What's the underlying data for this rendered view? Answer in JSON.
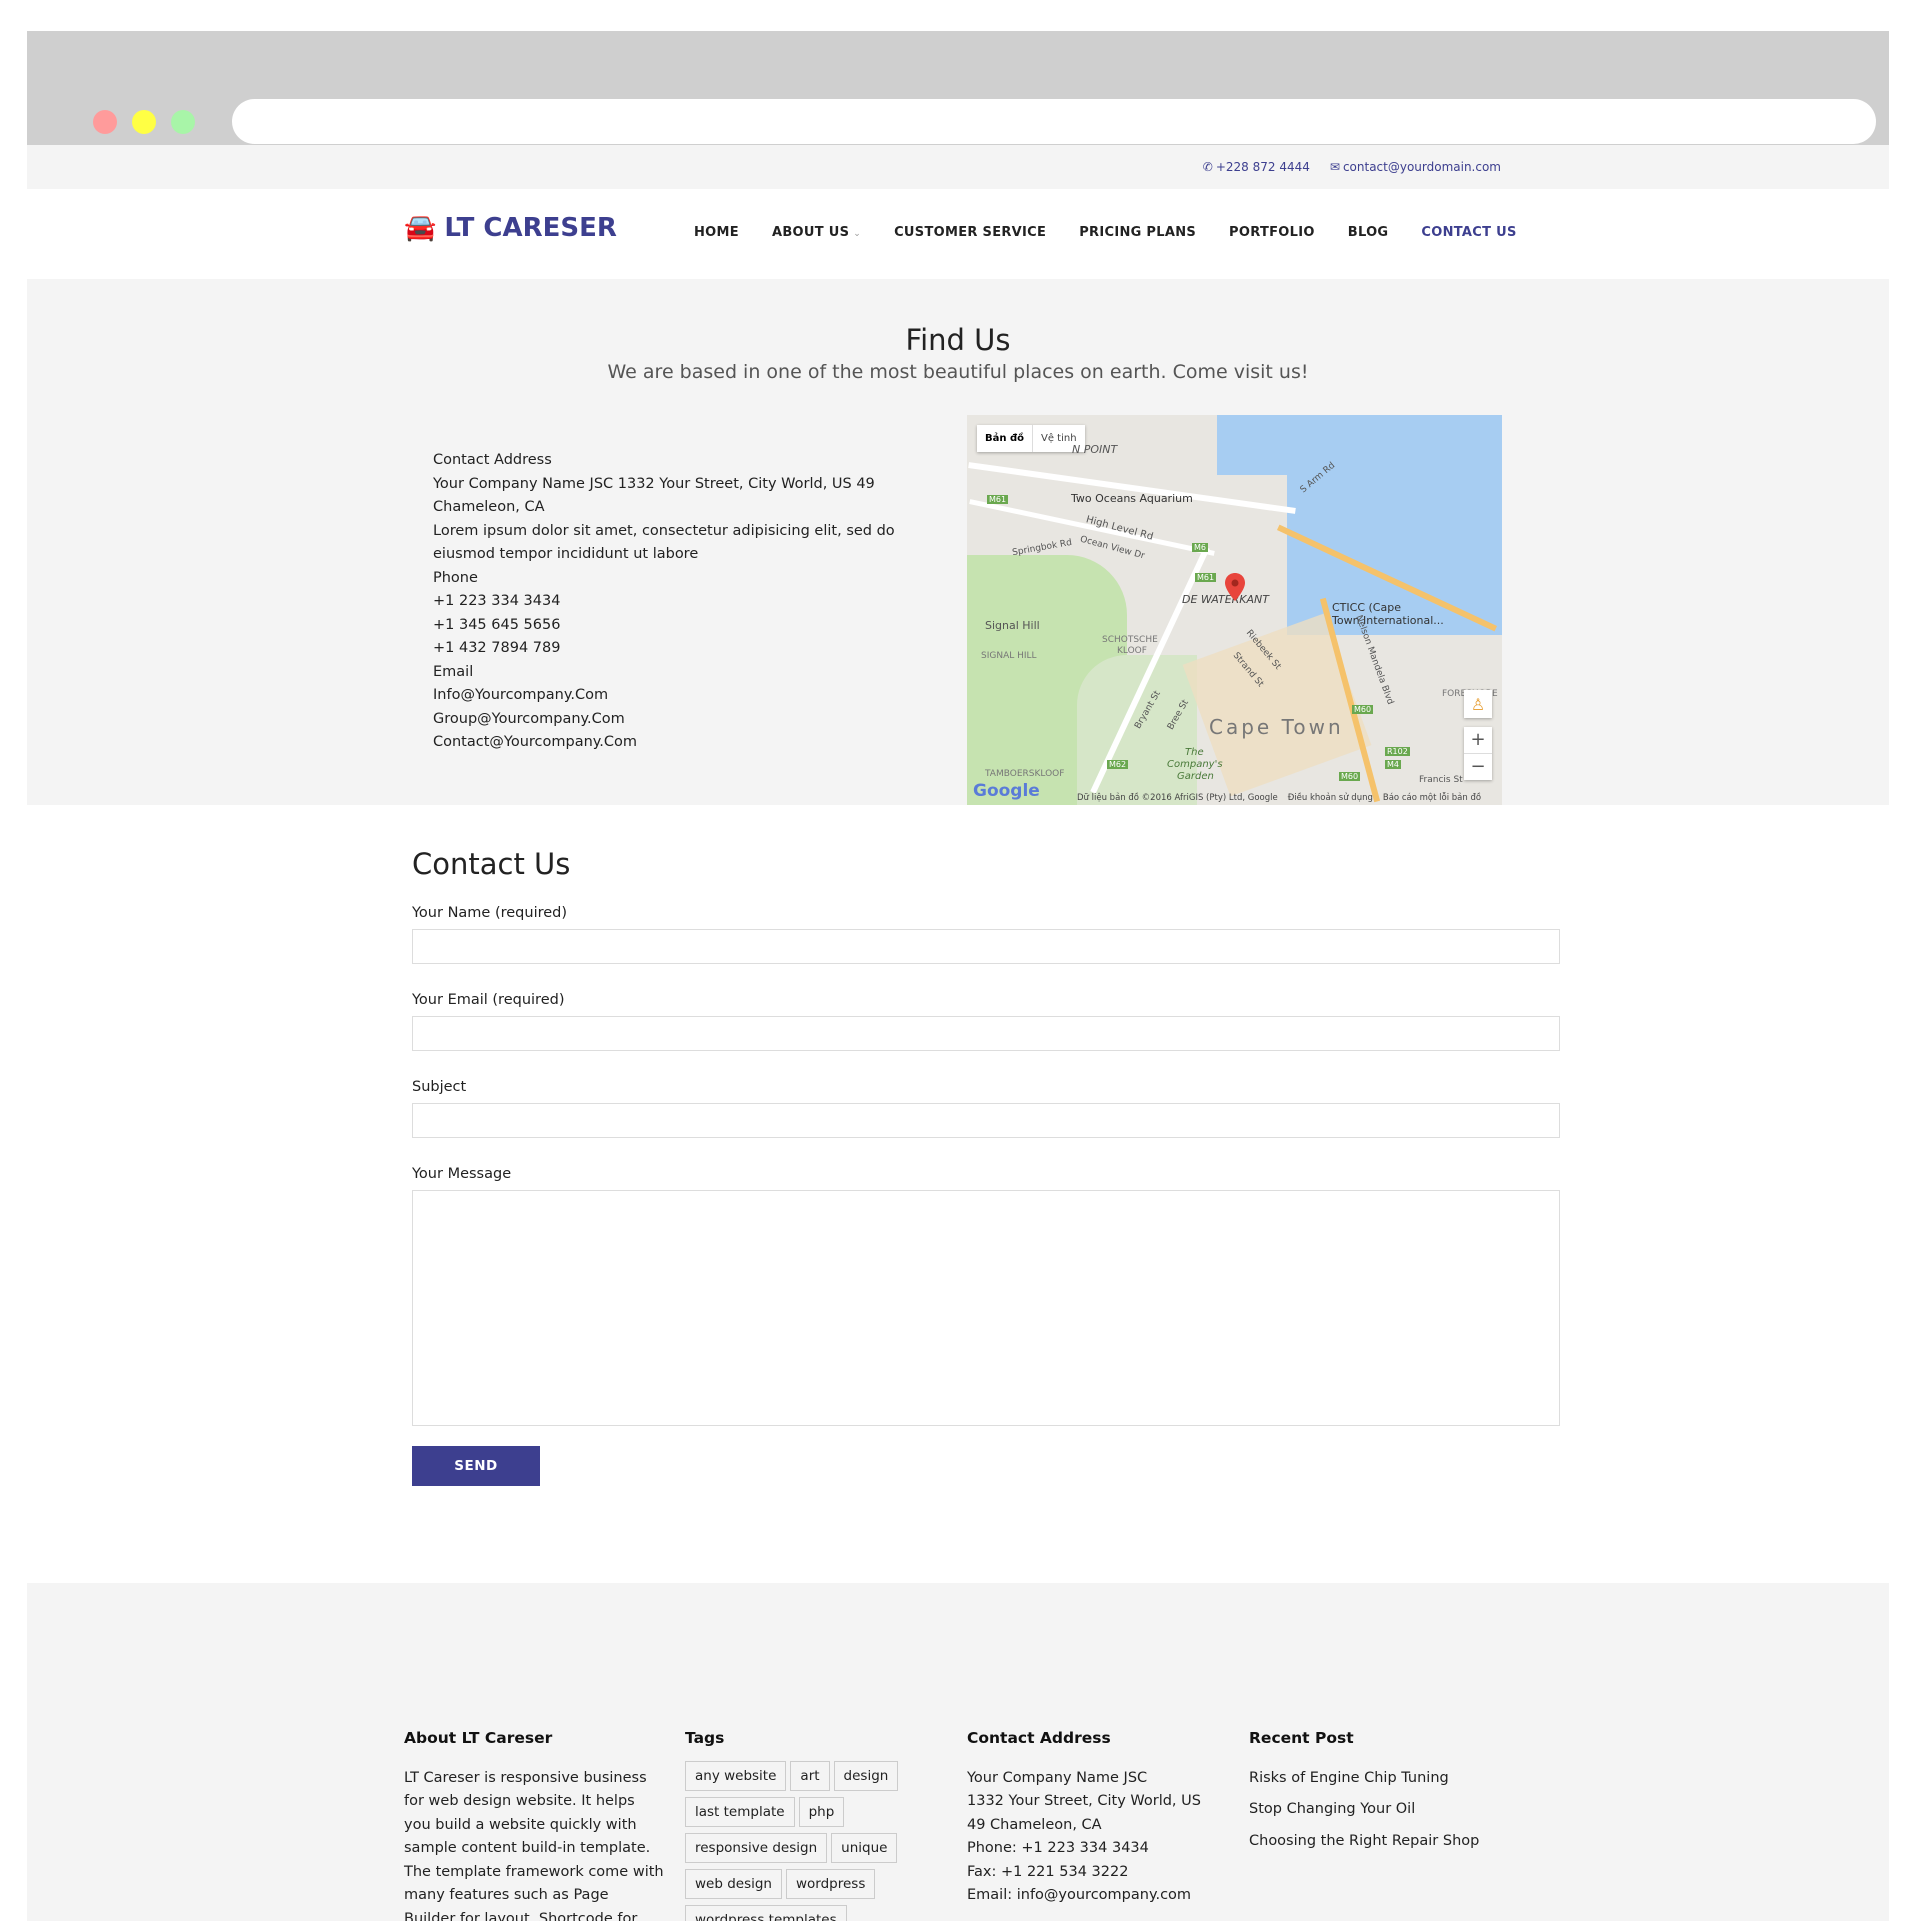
{
  "topbar": {
    "phone": "+228 872 4444",
    "email": "contact@yourdomain.com"
  },
  "logo": {
    "text": "LT CARESER"
  },
  "nav": {
    "home": "HOME",
    "about": "ABOUT US",
    "customer_service": "CUSTOMER SERVICE",
    "pricing": "PRICING PLANS",
    "portfolio": "PORTFOLIO",
    "blog": "BLOG",
    "contact": "CONTACT US"
  },
  "findus": {
    "title": "Find Us",
    "subtitle": "We are based in one of the most beautiful places on earth. Come visit us!",
    "address_lines": [
      "Contact Address",
      "Your Company Name JSC 1332 Your Street, City World, US 49",
      "Chameleon, CA",
      "Lorem ipsum dolor sit amet, consectetur adipisicing elit, sed do",
      "eiusmod tempor incididunt ut labore",
      "Phone",
      "+1 223 334 3434",
      "+1 345 645 5656",
      "+1 432 7894 789",
      "Email",
      "Info@Yourcompany.Com",
      "Group@Yourcompany.Com",
      "Contact@Yourcompany.Com"
    ]
  },
  "map": {
    "tab_map": "Bản đồ",
    "tab_satellite": "Vệ tinh",
    "labels": {
      "point": "N POINT",
      "aquarium": "Two Oceans Aquarium",
      "high_level": "High Level Rd",
      "springbok": "Springbok Rd",
      "ocean_view": "Ocean View Dr",
      "waterkant": "DE WATERKANT",
      "ctcc": "CTICC (Cape",
      "ctcc2": "Town International...",
      "signal_hill": "Signal Hill",
      "signal_hill2": "SIGNAL HILL",
      "schotsche": "SCHOTSCHE",
      "kloof": "KLOOF",
      "cape_town": "Cape Town",
      "tamboers": "TAMBOERSKLOOF",
      "company": "The",
      "company2": "Company's",
      "company3": "Garden",
      "nelson": "Nelson Mandela Blvd",
      "francis": "Francis St",
      "riebeek": "Riebeek St",
      "strand": "Strand St",
      "bree": "Bree St",
      "bryant": "Bryant St",
      "m6": "M6",
      "m61": "M61",
      "m60": "M60",
      "m62": "M62",
      "m4": "M4",
      "r102": "R102",
      "s_arm": "S Arm Rd",
      "fore": "FORESHORE"
    },
    "google": "Google",
    "footer_data": "Dữ liệu bản đồ ©2016 AfriGIS (Pty) Ltd, Google",
    "footer_terms": "Điều khoản sử dụng",
    "footer_report": "Báo cáo một lỗi bản đồ",
    "zoom_in": "+",
    "zoom_out": "−"
  },
  "contact": {
    "title": "Contact Us",
    "name_label": "Your Name (required)",
    "email_label": "Your Email (required)",
    "subject_label": "Subject",
    "message_label": "Your Message",
    "send": "SEND"
  },
  "footer": {
    "about_title": "About LT Careser",
    "about_text": "LT Careser is responsive business for web design website. It helps you build a website quickly with sample content build-in template. The template framework come with many features such as Page Builder for layout, Shortcode for",
    "tags_title": "Tags",
    "tags": [
      "any website",
      "art",
      "design",
      "last template",
      "php",
      "responsive design",
      "unique",
      "web design",
      "wordpress",
      "wordpress templates"
    ],
    "addr_title": "Contact Address",
    "addr_lines": [
      "Your Company Name JSC",
      "1332 Your Street, City World, US",
      "49 Chameleon, CA",
      "Phone: +1 223 334 3434",
      "Fax: +1 221 534 3222",
      "Email: info@yourcompany.com"
    ],
    "recent_title": "Recent Post",
    "recent": [
      "Risks of Engine Chip Tuning",
      "Stop Changing Your Oil",
      "Choosing the Right Repair Shop"
    ]
  },
  "colors": {
    "brand": "#3d3f8f",
    "panel": "#f4f4f4"
  }
}
